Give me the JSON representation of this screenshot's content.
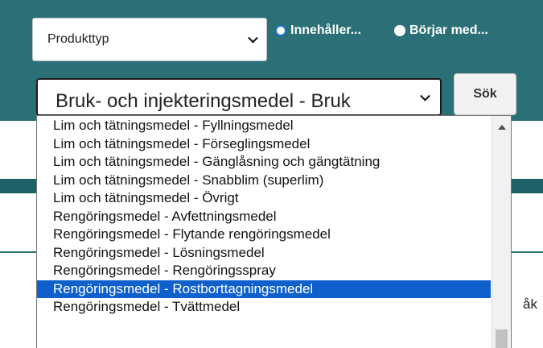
{
  "filters": {
    "type_select_label": "Produkttyp",
    "radio_contains": "Innehåller...",
    "radio_starts": "Börjar med...",
    "category_select_value": "Bruk- och injekteringsmedel - Bruk",
    "search_button": "Sök"
  },
  "dropdown": {
    "options": [
      "Lim och tätningsmedel - Fyllningsmedel",
      "Lim och tätningsmedel - Förseglingsmedel",
      "Lim och tätningsmedel - Gänglåsning och gängtätning",
      "Lim och tätningsmedel - Snabblim (superlim)",
      "Lim och tätningsmedel - Övrigt",
      "Rengöringsmedel - Avfettningsmedel",
      "Rengöringsmedel - Flytande rengöringsmedel",
      "Rengöringsmedel - Lösningsmedel",
      "Rengöringsmedel - Rengöringsspray",
      "Rengöringsmedel - Rostborttagningsmedel",
      "Rengöringsmedel - Tvättmedel"
    ],
    "highlighted_index": 9
  },
  "background_text": "åk",
  "colors": {
    "panel": "#2b7076",
    "highlight": "#0f60cc",
    "radio_selected": "#1c6fd6"
  }
}
